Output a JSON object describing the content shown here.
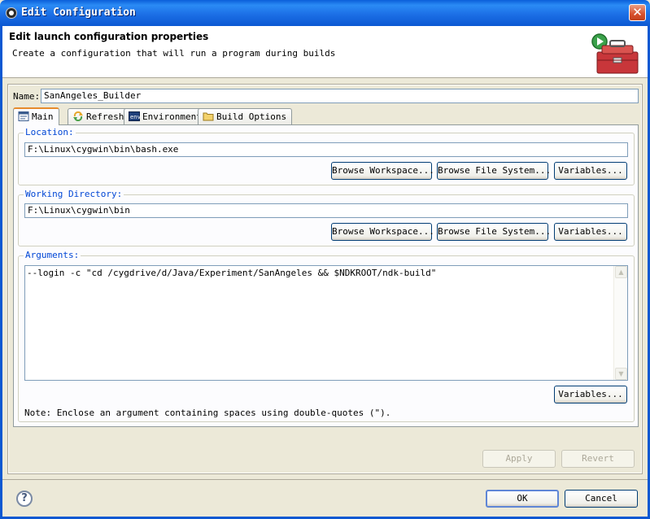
{
  "window": {
    "title": "Edit Configuration",
    "close_glyph": "✕"
  },
  "header": {
    "title": "Edit launch configuration properties",
    "subtitle": "Create a configuration that will run a program during builds"
  },
  "name": {
    "label": "Name:",
    "value": "SanAngeles_Builder"
  },
  "tabs": [
    {
      "label": "Main",
      "icon": "main-tab-icon",
      "active": true
    },
    {
      "label": "Refresh",
      "icon": "refresh-icon"
    },
    {
      "label": "Environment",
      "icon": "environment-icon"
    },
    {
      "label": "Build Options",
      "icon": "folder-icon"
    }
  ],
  "location": {
    "label": "Location:",
    "value": "F:\\Linux\\cygwin\\bin\\bash.exe",
    "buttons": [
      "Browse Workspace...",
      "Browse File System...",
      "Variables..."
    ]
  },
  "working_dir": {
    "label": "Working Directory:",
    "value": "F:\\Linux\\cygwin\\bin",
    "buttons": [
      "Browse Workspace...",
      "Browse File System...",
      "Variables..."
    ]
  },
  "arguments": {
    "label": "Arguments:",
    "value": "--login -c \"cd /cygdrive/d/Java/Experiment/SanAngeles && $NDKROOT/ndk-build\"",
    "variables_button": "Variables...",
    "note": "Note: Enclose an argument containing spaces using double-quotes (\")."
  },
  "footer": {
    "apply": "Apply",
    "revert": "Revert",
    "ok": "OK",
    "cancel": "Cancel",
    "help_glyph": "?"
  },
  "colors": {
    "titlebar": "#0b58d2",
    "group_label": "#0046d5",
    "active_tab_accent": "#e68b2c"
  }
}
